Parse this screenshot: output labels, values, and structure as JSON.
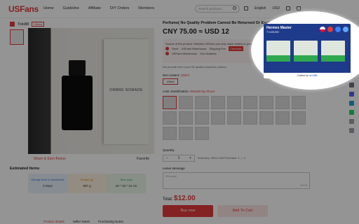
{
  "header": {
    "logo_main": "USFans",
    "nav": [
      "Home",
      "Guideline",
      "Affiliate",
      "DIY Orders",
      "Members"
    ],
    "search_placeholder": "Search products...",
    "language": "English",
    "currency": "USD"
  },
  "product": {
    "shop_name": "Tolo88",
    "shop_tag": "Official",
    "title": "Perfume( No Quality Problem Cannot Be Returned Or Exchanged)",
    "price": "CNY 75.00 ≈ USD 12",
    "box_text": "OMBRE NOMADE",
    "notice": {
      "line1": "Source of the product: Weidian  USFans can only reach sellers to purchase",
      "line2_a": "Store",
      "line2_b": "USFans Warehouse",
      "line2_c": "Shipping Fee",
      "line2_tag": "Calculate",
      "line3_a": "USFans Warehouse",
      "line3_b": "Your Address"
    },
    "reminder": "We provide free 3 pcs HD quality inspection photos",
    "net_content_label": "Net content:",
    "net_content_value": "100ml",
    "net_content_chip": "100ml",
    "color_label": "color classification:",
    "color_value": "Wandering Ghost",
    "quantity_label": "Quantity",
    "quantity_value": "1",
    "stock_text": "Inventory: 3994   Limit Purchase: 1 — 1",
    "message_label": "Leave Message",
    "message_placeholder": "Message",
    "message_count": "0/100",
    "total_label": "Total:",
    "total_value": "$12.00",
    "buy_label": "Buy now",
    "cart_label": "Add To Cart",
    "share_label": "Share & Earn Bonus",
    "fav_label": "Favorite"
  },
  "estimate": {
    "title": "Estimated Items",
    "cards": [
      {
        "label": "Storage time in warehouse",
        "value": "3 Days"
      },
      {
        "label": "Weight (g)",
        "value": "997 g"
      },
      {
        "label": "Size (cm)",
        "value": "18 * 18 * 12 cm"
      }
    ]
  },
  "tabs": [
    "Product details",
    "Seller Notes",
    "Purchasing Notes"
  ],
  "popup": {
    "title": "Hermes Master",
    "id": "TI #451895",
    "footer_prefix": "Crafted by",
    "footer_brand": "weidi88"
  },
  "colors": {
    "accent": "#e4393c",
    "popup_bg": "#1e3a8a",
    "green": "#2fa84f"
  }
}
